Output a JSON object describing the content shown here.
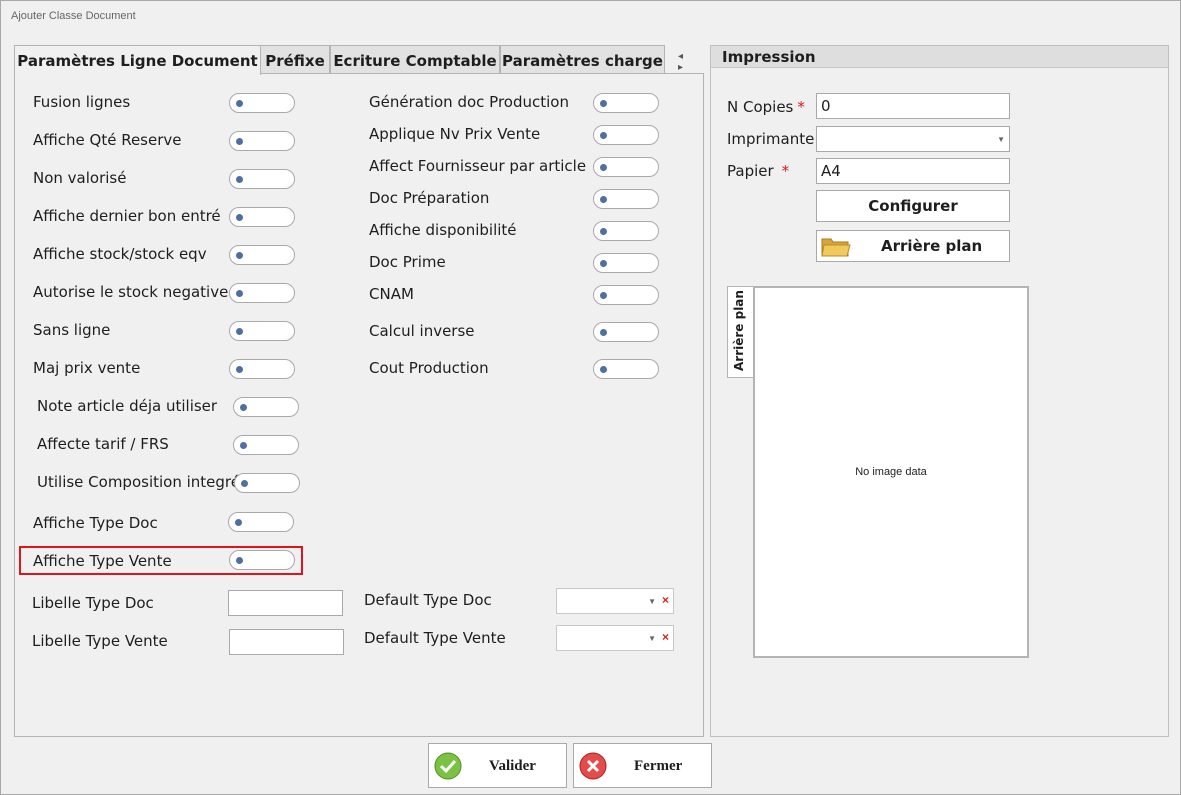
{
  "window": {
    "title": "Ajouter Classe Document"
  },
  "tabs": [
    {
      "label": "Paramètres Ligne Document",
      "active": true
    },
    {
      "label": "Préfixe",
      "active": false
    },
    {
      "label": "Ecriture Comptable",
      "active": false
    },
    {
      "label": "Paramètres charge",
      "active": false
    }
  ],
  "tab_scroll_arrows": "◂ ▸",
  "left_options": [
    {
      "label": "Fusion lignes",
      "checked": false
    },
    {
      "label": "Affiche Qté Reserve",
      "checked": false
    },
    {
      "label": "Non valorisé",
      "checked": false
    },
    {
      "label": "Affiche dernier bon entré",
      "checked": false
    },
    {
      "label": "Affiche stock/stock eqv",
      "checked": false
    },
    {
      "label": "Autorise le stock negative",
      "checked": false
    },
    {
      "label": "Sans ligne",
      "checked": false
    },
    {
      "label": "Maj prix vente",
      "checked": false
    },
    {
      "label": "Note article déja utiliser",
      "checked": false
    },
    {
      "label": "Affecte tarif / FRS",
      "checked": false
    },
    {
      "label": "Utilise Composition integré",
      "checked": false
    },
    {
      "label": "Affiche Type Doc",
      "checked": false
    },
    {
      "label": "Affiche Type Vente",
      "checked": false
    }
  ],
  "right_options": [
    {
      "label": "Génération doc Production",
      "checked": false
    },
    {
      "label": "Applique Nv Prix Vente",
      "checked": false
    },
    {
      "label": "Affect Fournisseur par article",
      "checked": false
    },
    {
      "label": "Doc Préparation",
      "checked": false
    },
    {
      "label": "Affiche disponibilité",
      "checked": false
    },
    {
      "label": "Doc Prime",
      "checked": false
    },
    {
      "label": "CNAM",
      "checked": false
    },
    {
      "label": "Calcul inverse",
      "checked": false
    },
    {
      "label": "Cout Production",
      "checked": false
    }
  ],
  "fields": {
    "libelle_type_doc": {
      "label": "Libelle Type Doc",
      "value": ""
    },
    "libelle_type_vente": {
      "label": "Libelle Type Vente",
      "value": ""
    },
    "default_type_doc": {
      "label": "Default Type Doc",
      "value": ""
    },
    "default_type_vente": {
      "label": "Default Type Vente",
      "value": ""
    }
  },
  "impression": {
    "title": "Impression",
    "n_copies": {
      "label": "N Copies",
      "required_mark": "*",
      "value": "0"
    },
    "imprimante": {
      "label": "Imprimante",
      "value": ""
    },
    "papier": {
      "label": "Papier",
      "required_mark": "*",
      "value": "A4"
    },
    "configurer_label": "Configurer",
    "arriere_plan_label": "Arrière plan",
    "vertical_tab_label": "Arrière plan",
    "no_image_text": "No image data"
  },
  "buttons": {
    "valider": "Valider",
    "fermer": "Fermer"
  },
  "colors": {
    "toggle_knob": "#4e6fa3",
    "highlight_border": "#e0141e",
    "required": "#e0141e"
  }
}
